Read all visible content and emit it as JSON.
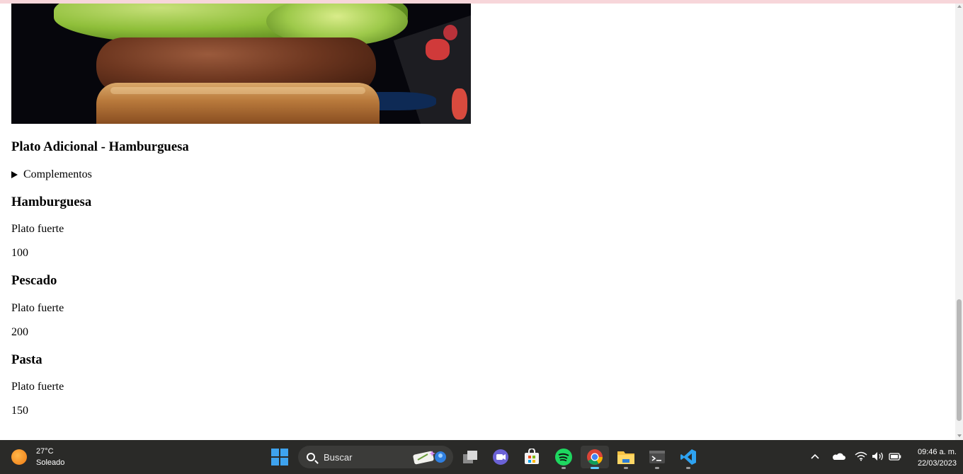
{
  "menu": {
    "featured": {
      "title": "Plato Adicional - Hamburguesa",
      "details_summary": "Complementos"
    },
    "items": [
      {
        "name": "Hamburguesa",
        "category": "Plato fuerte",
        "price": "100"
      },
      {
        "name": "Pescado",
        "category": "Plato fuerte",
        "price": "200"
      },
      {
        "name": "Pasta",
        "category": "Plato fuerte",
        "price": "150"
      }
    ]
  },
  "taskbar": {
    "weather": {
      "temperature": "27°C",
      "condition": "Soleado"
    },
    "search_label": "Buscar",
    "clock": {
      "time": "09:46 a. m.",
      "date": "22/03/2023"
    },
    "apps": [
      "windows-start-icon",
      "search-icon",
      "task-view-icon",
      "teams-chat-icon",
      "microsoft-store-icon",
      "spotify-icon",
      "chrome-icon",
      "file-explorer-icon",
      "terminal-icon",
      "vscode-icon"
    ],
    "tray_icons": [
      "chevron-up-icon",
      "onedrive-cloud-icon",
      "wifi-icon",
      "volume-icon",
      "battery-icon"
    ]
  },
  "colors": {
    "top_strip": "#f7d6da",
    "taskbar_bg": "#2a2a28",
    "active_indicator": "#60cdff"
  }
}
